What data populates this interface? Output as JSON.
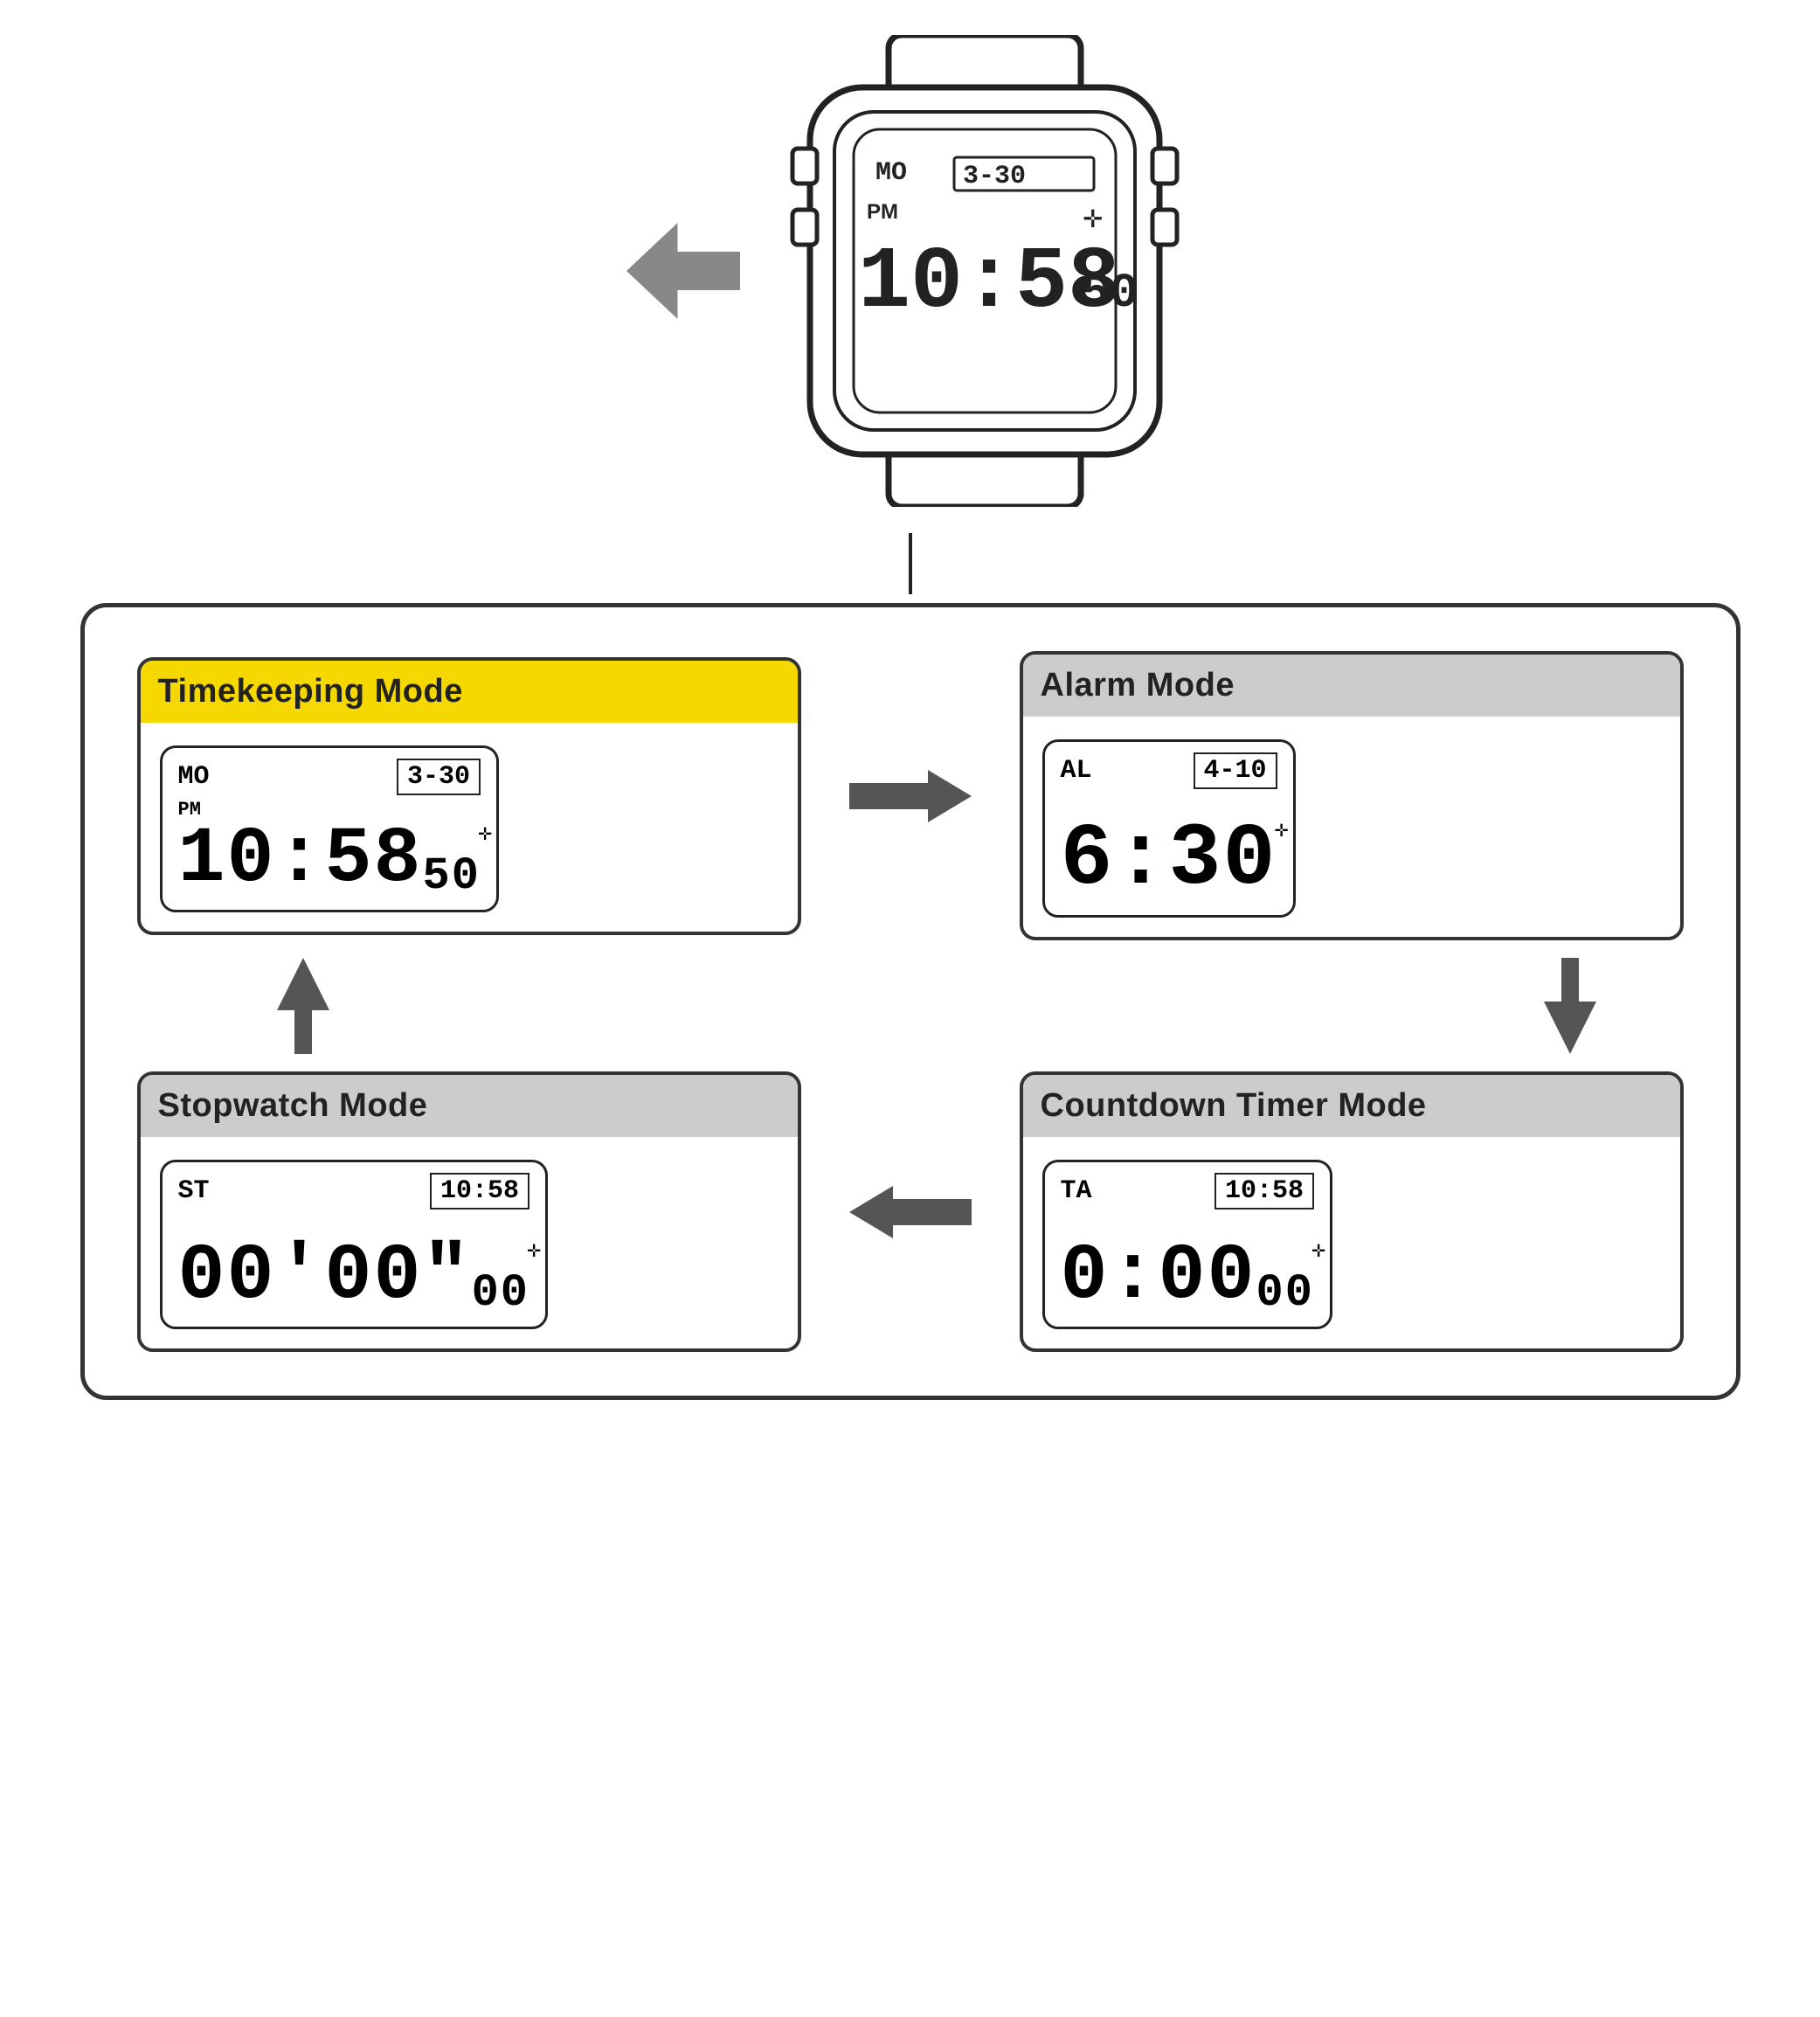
{
  "watch": {
    "top_label": "MO",
    "top_date": "3-30",
    "pm": "PM",
    "main_time": "10:58",
    "seconds": "50",
    "compass": "✛"
  },
  "modes": {
    "timekeeping": {
      "title": "Timekeeping Mode",
      "label": "MO",
      "date": "3-30",
      "pm": "PM",
      "time": "10:58",
      "seconds": "50",
      "compass": "✛",
      "highlight": true
    },
    "alarm": {
      "title": "Alarm Mode",
      "label": "AL",
      "date": "4-10",
      "pm": "",
      "time": "6:30",
      "seconds": "",
      "compass": "✛",
      "highlight": false
    },
    "stopwatch": {
      "title": "Stopwatch Mode",
      "label": "ST",
      "date": "10:58",
      "pm": "",
      "time": "00'00\"",
      "seconds": "00",
      "compass": "✛",
      "highlight": false
    },
    "countdown": {
      "title": "Countdown Timer Mode",
      "label": "TA",
      "date": "10:58",
      "pm": "",
      "time": "0:00",
      "seconds": "00",
      "compass": "✛",
      "highlight": false
    }
  },
  "arrows": {
    "right": "→",
    "left": "←",
    "down": "↓",
    "up": "↑"
  }
}
